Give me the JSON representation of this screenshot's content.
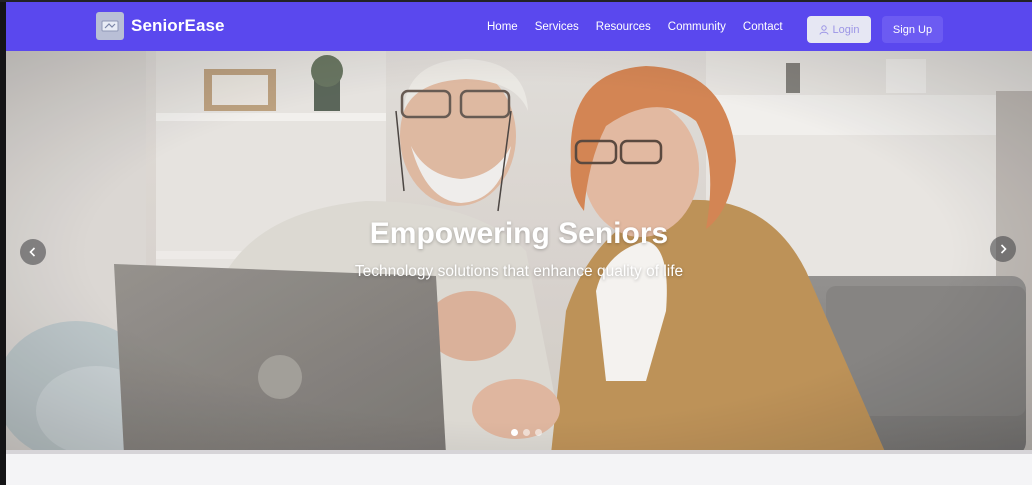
{
  "brand": {
    "name": "SeniorEase",
    "logo_icon": "logo-icon"
  },
  "nav": {
    "links": [
      "Home",
      "Services",
      "Resources",
      "Community",
      "Contact"
    ],
    "login_label": "Login",
    "signup_label": "Sign Up"
  },
  "hero": {
    "title": "Empowering Seniors",
    "subtitle": "Technology solutions that enhance quality of life",
    "slides_total": 3,
    "active_slide": 1,
    "prev_icon": "chevron-left-icon",
    "next_icon": "chevron-right-icon"
  },
  "colors": {
    "nav_bg": "#5a48ee",
    "signup_bg": "#6c5bf2",
    "login_bg": "#e6e7f3",
    "login_text": "#9c95e6"
  }
}
